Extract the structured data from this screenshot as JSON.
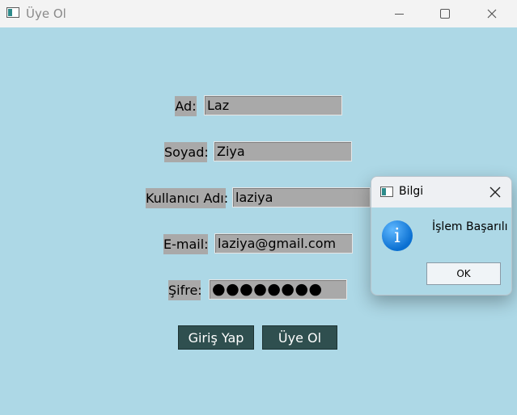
{
  "window": {
    "title": "Üye Ol"
  },
  "form": {
    "ad_label": "Ad:",
    "ad_value": "Laz",
    "soyad_label": "Soyad:",
    "soyad_value": "Ziya",
    "kullanici_label": "Kullanıcı Adı:",
    "kullanici_value": "laziya",
    "email_label": "E-mail:",
    "email_value": "laziya@gmail.com",
    "sifre_label": "Şifre:",
    "sifre_value": "●●●●●●●●"
  },
  "buttons": {
    "login": "Giriş Yap",
    "register": "Üye Ol"
  },
  "dialog": {
    "title": "Bilgi",
    "message": "İşlem Başarılı",
    "ok": "OK",
    "icon": "info-icon"
  },
  "colors": {
    "background": "#add8e6",
    "field": "#a9a9a9",
    "button": "#2f4f4f"
  }
}
